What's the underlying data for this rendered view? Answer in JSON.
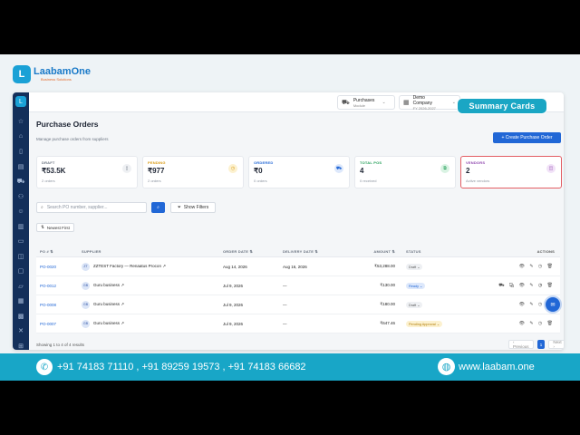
{
  "brand": {
    "name": "LaabamOne",
    "tagline": "Business Solutions"
  },
  "callout": "Summary Cards",
  "topbar": {
    "module": {
      "label": "Purchases",
      "sub": "Module"
    },
    "company": {
      "label": "Demo Company",
      "sub": "FY 2026-2027"
    }
  },
  "page": {
    "title": "Purchase Orders",
    "subtitle": "Manage purchase orders from suppliers",
    "create_label": "+ Create Purchase Order"
  },
  "cards": [
    {
      "label": "DRAFT",
      "value": "₹53.5K",
      "sub": "2 orders",
      "color": "#6a7380",
      "icon": "document-icon"
    },
    {
      "label": "PENDING",
      "value": "₹977",
      "sub": "2 orders",
      "color": "#d99a12",
      "icon": "clock-icon"
    },
    {
      "label": "ORDERED",
      "value": "₹0",
      "sub": "0 orders",
      "color": "#2167d6",
      "icon": "truck-icon"
    },
    {
      "label": "TOTAL POS",
      "value": "4",
      "sub": "0 received",
      "color": "#1f9d55",
      "icon": "copy-icon"
    },
    {
      "label": "VENDORS",
      "value": "2",
      "sub": "Active vendors",
      "color": "#8e44ad",
      "icon": "box-icon"
    }
  ],
  "toolbar": {
    "search_placeholder": "Search PO number, supplier...",
    "filters_label": "Show Filters",
    "sort_label": "Newest First"
  },
  "table": {
    "headers": {
      "po": "PO # ⇅",
      "supplier": "SUPPLIER",
      "order_date": "ORDER DATE ⇅",
      "delivery_date": "DELIVERY DATE ⇅",
      "amount": "AMOUNT ⇅",
      "status": "STATUS",
      "actions": "ACTIONS"
    },
    "rows": [
      {
        "po": "PO-0020",
        "avatar": "ZT",
        "supplier": "ZZTEST Factory — Renaatus Procon ↗",
        "order_date": "Aug 14, 2026",
        "delivery_date": "Aug 16, 2026",
        "amount": "₹53,288.00",
        "status": "Draft ⌄",
        "actions": "👁 ✎ ◷ 🗑"
      },
      {
        "po": "PO-0012",
        "avatar": "GB",
        "supplier": "Guru business ↗",
        "order_date": "Jul 9, 2026",
        "delivery_date": "—",
        "amount": "₹130.00",
        "status": "Ready ⌄",
        "actions": "⛟ ⧉ 👁 ✎ ◷ 🗑"
      },
      {
        "po": "PO-0008",
        "avatar": "GB",
        "supplier": "Guru business ↗",
        "order_date": "Jul 9, 2026",
        "delivery_date": "—",
        "amount": "₹180.00",
        "status": "Draft ⌄",
        "actions": "👁 ✎ ◷ 🗑"
      },
      {
        "po": "PO-0007",
        "avatar": "GB",
        "supplier": "Guru business ↗",
        "order_date": "Jul 9, 2026",
        "delivery_date": "—",
        "amount": "₹647.46",
        "status": "Pending Approval ⌄",
        "actions": "👁 ✎ ◷ 🗑"
      }
    ]
  },
  "footer": {
    "showing": "Showing 1 to 4 of 4 results",
    "prev": "‹ Previous",
    "page": "1",
    "next": "Next ›"
  },
  "contact": {
    "phones": "+91 74183 71110 ,  +91 89259 19573 ,  +91 74183 66682",
    "website": "www.laabam.one"
  },
  "colors": {
    "accent": "#2167d6",
    "banner": "#18a6c7",
    "sidebar": "#132f5a"
  }
}
